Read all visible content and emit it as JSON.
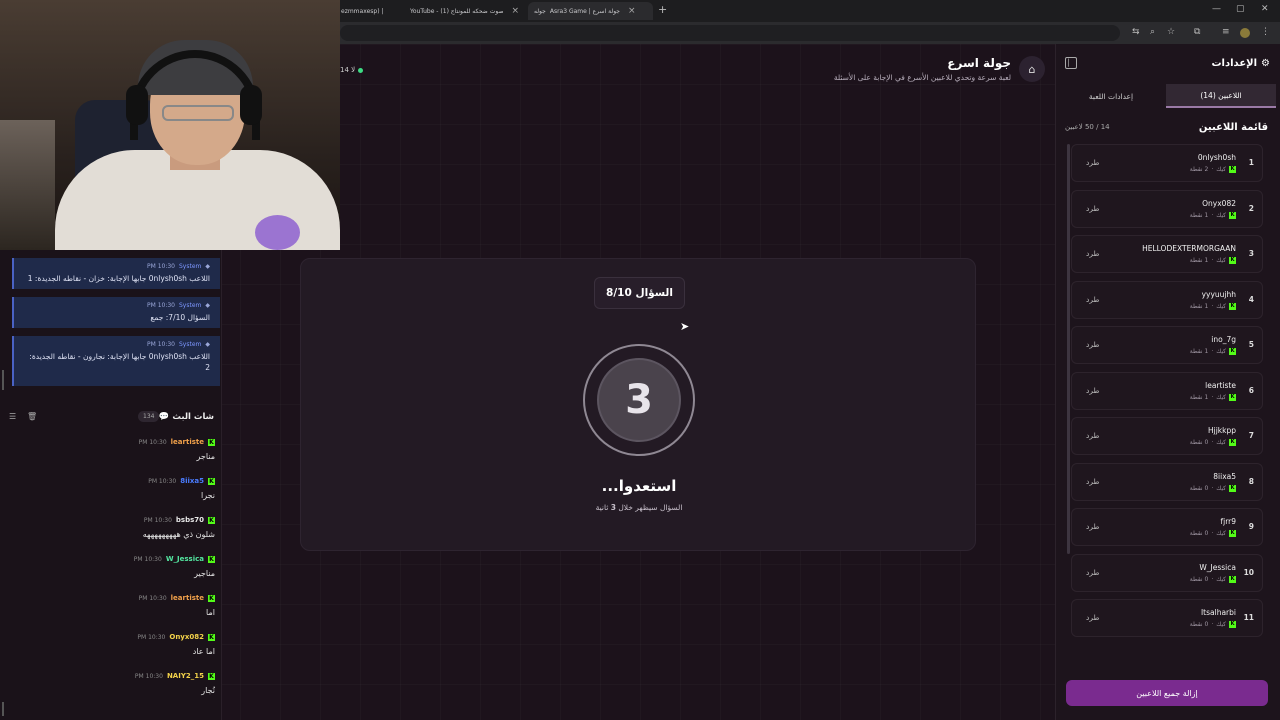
{
  "browser": {
    "tabs": [
      {
        "title": "ezmmaxesp) | "
      },
      {
        "title": "YouTube - صوت ضحكه للمونتاج (1)"
      },
      {
        "title": "جوله"
      },
      {
        "title": "Asra3 Game | جولة اسرع"
      }
    ]
  },
  "chat": {
    "system_messages": [
      {
        "time": "10:30 PM",
        "user": "System",
        "text": "اللاعب 0nlysh0sh جابها الإجابة: خزان - نقاطه الجديدة: 1"
      },
      {
        "time": "10:30 PM",
        "user": "System",
        "text": "السؤال 7/10: جمع"
      },
      {
        "time": "10:30 PM",
        "user": "System",
        "text": "اللاعب 0nlysh0sh جابها الإجابة: نجارون - نقاطه الجديدة: 2"
      }
    ],
    "title": "شات البث",
    "count": "134",
    "messages": [
      {
        "time": "10:30 PM",
        "user": "leartiste",
        "color": "#f0a04a",
        "text": "مناجر"
      },
      {
        "time": "10:30 PM",
        "user": "8iixa5",
        "color": "#4a7cff",
        "text": "نجرا"
      },
      {
        "time": "10:30 PM",
        "user": "bsbs70",
        "color": "#e8e8e8",
        "text": "شلون ذي هههههههههه"
      },
      {
        "time": "10:30 PM",
        "user": "W_Jessica",
        "color": "#53e6a0",
        "text": "مناجير"
      },
      {
        "time": "10:30 PM",
        "user": "leartiste",
        "color": "#f0a04a",
        "text": "اما"
      },
      {
        "time": "10:30 PM",
        "user": "Onyx082",
        "color": "#f3d24a",
        "text": "اما عاد"
      },
      {
        "time": "10:30 PM",
        "user": "NAIY2_15",
        "color": "#f3d24a",
        "text": "نُجار"
      }
    ]
  },
  "header": {
    "title": "جولة اسرع",
    "subtitle": "لعبة سرعة وتحدي للاعبين الأسرع في الإجابة على الأسئلة",
    "online": "14 لا"
  },
  "game": {
    "question_badge": "السؤال 8/10",
    "countdown": "3",
    "ready": "استعدوا...",
    "ready_sub_pre": "السؤال سيظهر خلال",
    "ready_sub_num": "3",
    "ready_sub_post": "ثانية"
  },
  "panel": {
    "title": "الإعدادات",
    "tabs": {
      "players": "اللاعبين (14)",
      "game_settings": "إعدادات اللعبة"
    },
    "list_title": "قائمة اللاعبين",
    "list_count": "14 / 50 لاعبين",
    "kick_label": "طرد",
    "platform_label": "كيك",
    "remove_all": "إزالة جميع اللاعبين",
    "players": [
      {
        "num": "1",
        "name": "0nlysh0sh",
        "points": "2 نقطة"
      },
      {
        "num": "2",
        "name": "Onyx082",
        "points": "1 نقطة"
      },
      {
        "num": "3",
        "name": "HELLODEXTERMORGAAN",
        "points": "1 نقطة"
      },
      {
        "num": "4",
        "name": "yyyuujhh",
        "points": "1 نقطة"
      },
      {
        "num": "5",
        "name": "ino_7g",
        "points": "1 نقطة"
      },
      {
        "num": "6",
        "name": "leartiste",
        "points": "1 نقطة"
      },
      {
        "num": "7",
        "name": "Hjjkkpp",
        "points": "0 نقطة"
      },
      {
        "num": "8",
        "name": "8iixa5",
        "points": "0 نقطة"
      },
      {
        "num": "9",
        "name": "fjrr9",
        "points": "0 نقطة"
      },
      {
        "num": "10",
        "name": "W_Jessica",
        "points": "0 نقطة"
      },
      {
        "num": "11",
        "name": "Itsalharbi",
        "points": "0 نقطة"
      }
    ]
  }
}
